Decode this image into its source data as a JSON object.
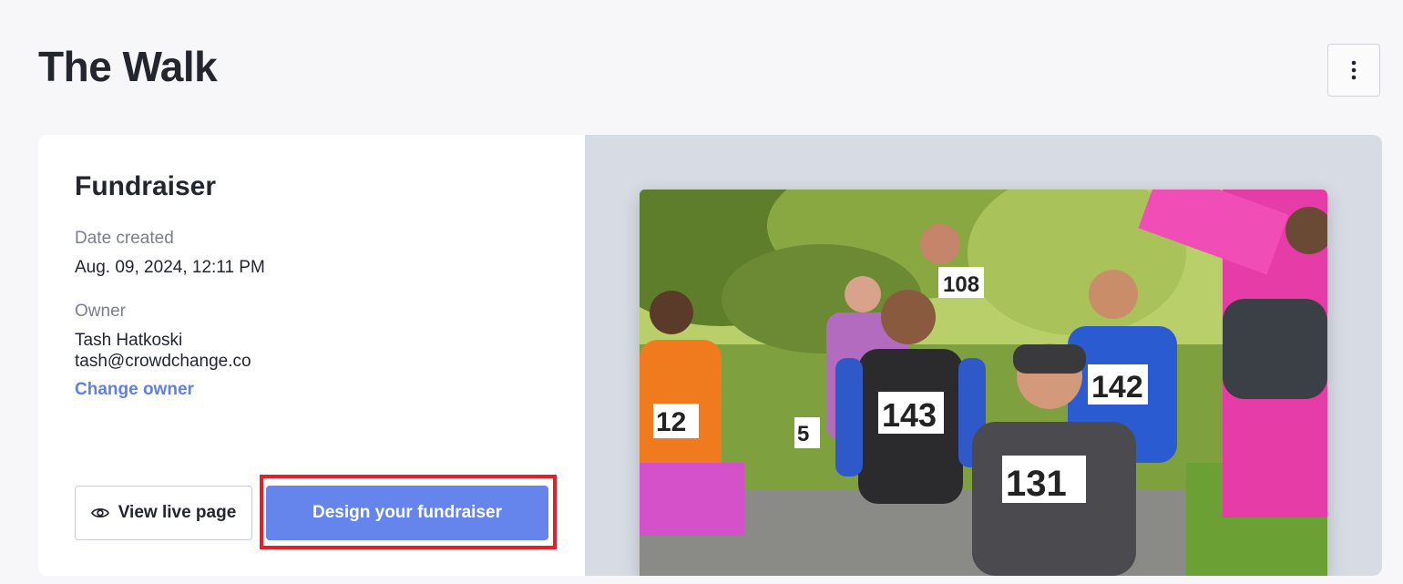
{
  "page": {
    "title": "The Walk",
    "more_icon": "vertical-ellipsis-icon"
  },
  "card": {
    "heading": "Fundraiser",
    "date_created_label": "Date created",
    "date_created_value": "Aug. 09, 2024, 12:11 PM",
    "owner_label": "Owner",
    "owner_name": "Tash Hatkoski",
    "owner_email": "tash@crowdchange.co",
    "change_owner_label": "Change owner",
    "view_live_label": "View live page",
    "view_live_icon": "eye-icon",
    "design_label": "Design your fundraiser"
  },
  "photo": {
    "bib_numbers": [
      "12",
      "143",
      "142",
      "131",
      "108",
      "5"
    ]
  },
  "colors": {
    "accent": "#6585ec",
    "link": "#5f7fe6",
    "highlight": "#e0202a",
    "photo_panel": "#d6dbe4"
  }
}
